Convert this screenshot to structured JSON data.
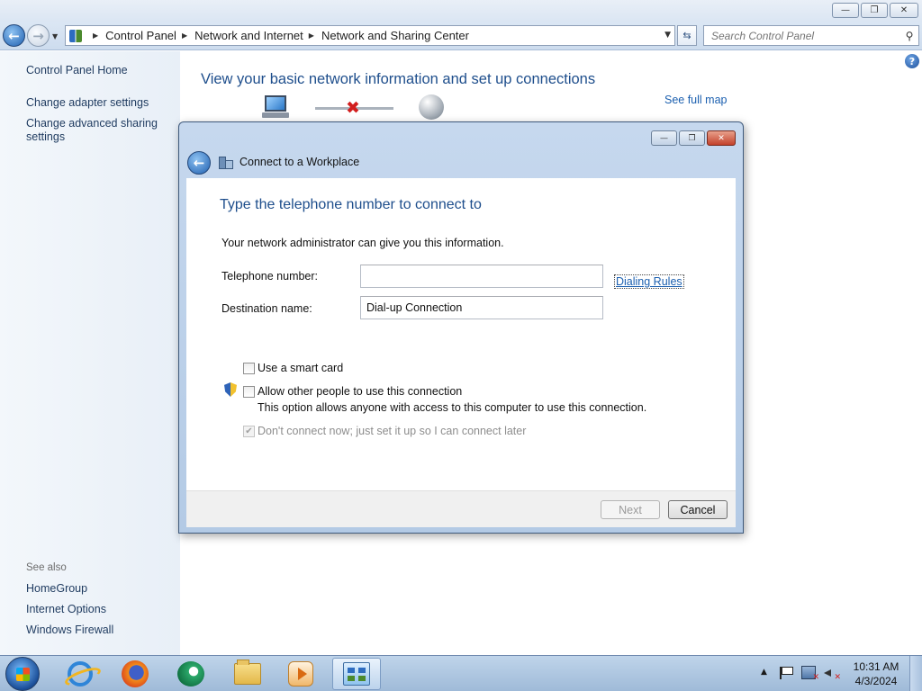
{
  "window": {
    "caption_buttons": {
      "minimize": "—",
      "maximize": "❐",
      "close": "✕"
    }
  },
  "address_bar": {
    "breadcrumbs": [
      "Control Panel",
      "Network and Internet",
      "Network and Sharing Center"
    ],
    "search_placeholder": "Search Control Panel"
  },
  "left_pane": {
    "links": [
      "Control Panel Home",
      "Change adapter settings",
      "Change advanced sharing settings"
    ],
    "see_also_label": "See also",
    "see_also_links": [
      "HomeGroup",
      "Internet Options",
      "Windows Firewall"
    ]
  },
  "main": {
    "heading": "View your basic network information and set up connections",
    "see_full_map": "See full map",
    "help_icon": "?"
  },
  "dialog": {
    "title": "Connect to a Workplace",
    "heading": "Type the telephone number to connect to",
    "info_text": "Your network administrator can give you this information.",
    "telephone_label": "Telephone number:",
    "telephone_value": "",
    "dialing_rules": "Dialing Rules",
    "destination_label": "Destination name:",
    "destination_value": "Dial-up Connection",
    "smart_card_label": "Use a smart card",
    "allow_others_label": "Allow other people to use this connection",
    "allow_others_desc": "This option allows anyone with access to this computer to use this connection.",
    "dont_connect_label": "Don't connect now; just set it up so I can connect later",
    "smart_card_checked": false,
    "allow_others_checked": false,
    "dont_connect_checked": true,
    "dont_connect_disabled": true,
    "next_button": "Next",
    "next_disabled": true,
    "cancel_button": "Cancel"
  },
  "taskbar": {
    "apps": [
      "internet-explorer",
      "firefox",
      "messenger",
      "windows-explorer",
      "media-center",
      "control-panel"
    ],
    "active_app": "control-panel",
    "clock_time": "10:31 AM",
    "clock_date": "4/3/2024"
  },
  "colors": {
    "heading_blue": "#1e4e8c",
    "link_blue": "#1b5faf",
    "dialog_frame": "#b3cae5",
    "taskbar": "#9fbad8"
  }
}
